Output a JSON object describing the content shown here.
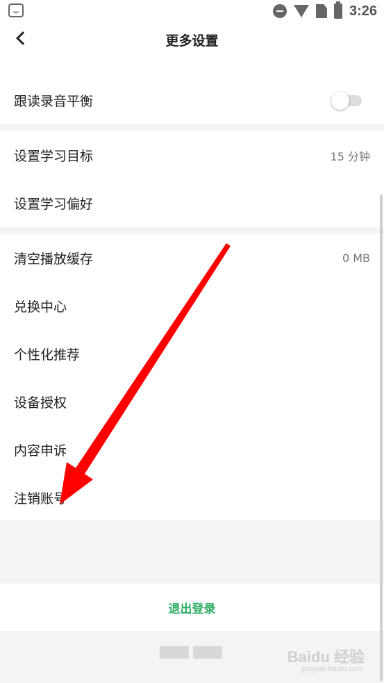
{
  "status_bar": {
    "time": "3:26",
    "icons": [
      "app-icon",
      "do-not-disturb-icon",
      "wifi-icon",
      "no-sim-icon",
      "battery-charging-icon"
    ]
  },
  "header": {
    "title": "更多设置",
    "back_icon": "chevron-left-icon"
  },
  "sections": [
    {
      "items": [
        {
          "label": "跟读录音平衡",
          "control": "toggle",
          "on": false
        }
      ]
    },
    {
      "items": [
        {
          "label": "设置学习目标",
          "value": "15 分钟"
        },
        {
          "label": "设置学习偏好"
        }
      ]
    },
    {
      "items": [
        {
          "label": "清空播放缓存",
          "value": "0 MB"
        },
        {
          "label": "兑换中心"
        },
        {
          "label": "个性化推荐"
        },
        {
          "label": "设备授权"
        },
        {
          "label": "内容申诉"
        },
        {
          "label": "注销账号"
        }
      ]
    }
  ],
  "logout": {
    "label": "退出登录"
  },
  "watermark": {
    "text": "Baidu 经验",
    "sub": "jingyan.baidu.com"
  },
  "colors": {
    "accent": "#2fae66",
    "annotation_arrow": "#ff0000"
  }
}
